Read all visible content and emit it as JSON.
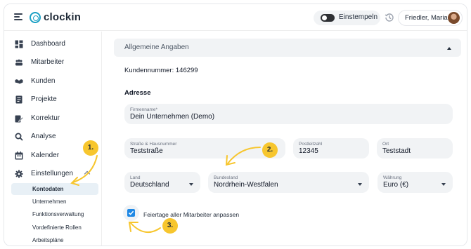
{
  "app": {
    "name": "clockin"
  },
  "header": {
    "stamp_label": "Einstempeln",
    "user_name": "Friedler, Maria"
  },
  "sidebar": {
    "items": [
      {
        "label": "Dashboard",
        "icon": "dashboard-icon"
      },
      {
        "label": "Mitarbeiter",
        "icon": "employees-icon"
      },
      {
        "label": "Kunden",
        "icon": "handshake-icon"
      },
      {
        "label": "Projekte",
        "icon": "folder-icon"
      },
      {
        "label": "Korrektur",
        "icon": "edit-icon"
      },
      {
        "label": "Analyse",
        "icon": "search-icon"
      },
      {
        "label": "Kalender",
        "icon": "calendar-icon"
      },
      {
        "label": "Einstellungen",
        "icon": "gear-icon",
        "expanded": true
      }
    ],
    "subitems": [
      {
        "label": "Kontodaten",
        "active": true
      },
      {
        "label": "Unternehmen"
      },
      {
        "label": "Funktionsverwaltung"
      },
      {
        "label": "Vordefinierte Rollen"
      },
      {
        "label": "Arbeitspläne"
      }
    ]
  },
  "main": {
    "section_title": "Allgemeine Angaben",
    "customer_number": "Kundennummer: 146299",
    "address_heading": "Adresse",
    "fields": {
      "company": {
        "label": "Firmenname*",
        "value": "Dein Unternehmen (Demo)"
      },
      "street": {
        "label": "Straße & Hausnummer",
        "value": "Teststraße"
      },
      "zip": {
        "label": "Postleitzahl",
        "value": "12345"
      },
      "city": {
        "label": "Ort",
        "value": "Teststadt"
      },
      "country": {
        "label": "Land",
        "value": "Deutschland"
      },
      "state": {
        "label": "Bundesland",
        "value": "Nordrhein-Westfalen"
      },
      "currency": {
        "label": "Währung",
        "value": "Euro (€)"
      }
    },
    "holidays_checkbox": {
      "label": "Feiertage aller Mitarbeiter anpassen",
      "checked": true
    }
  },
  "callouts": [
    "1.",
    "2.",
    "3."
  ],
  "colors": {
    "brand": "#1aa0c4",
    "accent_blue": "#1e88e5",
    "callout": "#f7c62e",
    "active_bg": "#e8f0f6",
    "field_bg": "#f1f3f5"
  }
}
